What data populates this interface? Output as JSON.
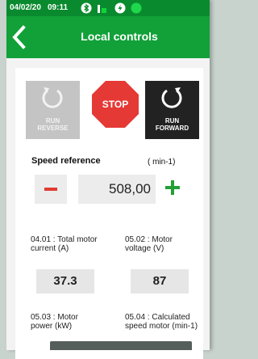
{
  "statusbar": {
    "date": "04/02/20",
    "time": "09:11"
  },
  "header": {
    "title": "Local controls"
  },
  "controls": {
    "reverse_label": "RUN\nREVERSE",
    "stop_label": "STOP",
    "forward_label": "RUN\nFORWARD"
  },
  "speed": {
    "title": "Speed reference",
    "unit": "( min-1)",
    "value": "508,00"
  },
  "params": [
    {
      "label": "04.01 : Total motor current (A)",
      "value": "37.3"
    },
    {
      "label": "05.02 : Motor voltage (V)",
      "value": "87"
    },
    {
      "label": "05.03 : Motor power (kW)"
    },
    {
      "label": "05.04 : Calculated speed motor (min-1)"
    }
  ],
  "colors": {
    "brand_green": "#11a138",
    "stop_red": "#e53935",
    "minus_red": "#e03c31",
    "plus_green": "#22a035"
  }
}
